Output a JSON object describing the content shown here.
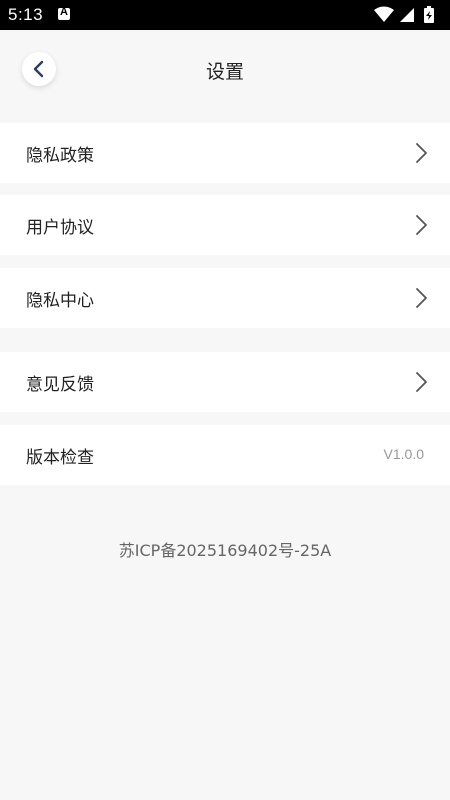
{
  "status_bar": {
    "time": "5:13",
    "icons": [
      "app-notification-icon",
      "wifi-icon",
      "signal-icon",
      "battery-charging-icon"
    ]
  },
  "header": {
    "title": "设置",
    "back_icon": "chevron-left-icon"
  },
  "settings": {
    "items": [
      {
        "label": "隐私政策"
      },
      {
        "label": "用户协议"
      },
      {
        "label": "隐私中心"
      },
      {
        "label": "意见反馈"
      },
      {
        "label": "版本检查",
        "value": "V1.0.0"
      }
    ]
  },
  "footer": {
    "icp": "苏ICP备2025169402号-25A"
  },
  "colors": {
    "background": "#f7f7f7",
    "card": "#ffffff",
    "text_primary": "#222222",
    "text_secondary": "#999999",
    "back_arrow": "#2c3e66"
  }
}
